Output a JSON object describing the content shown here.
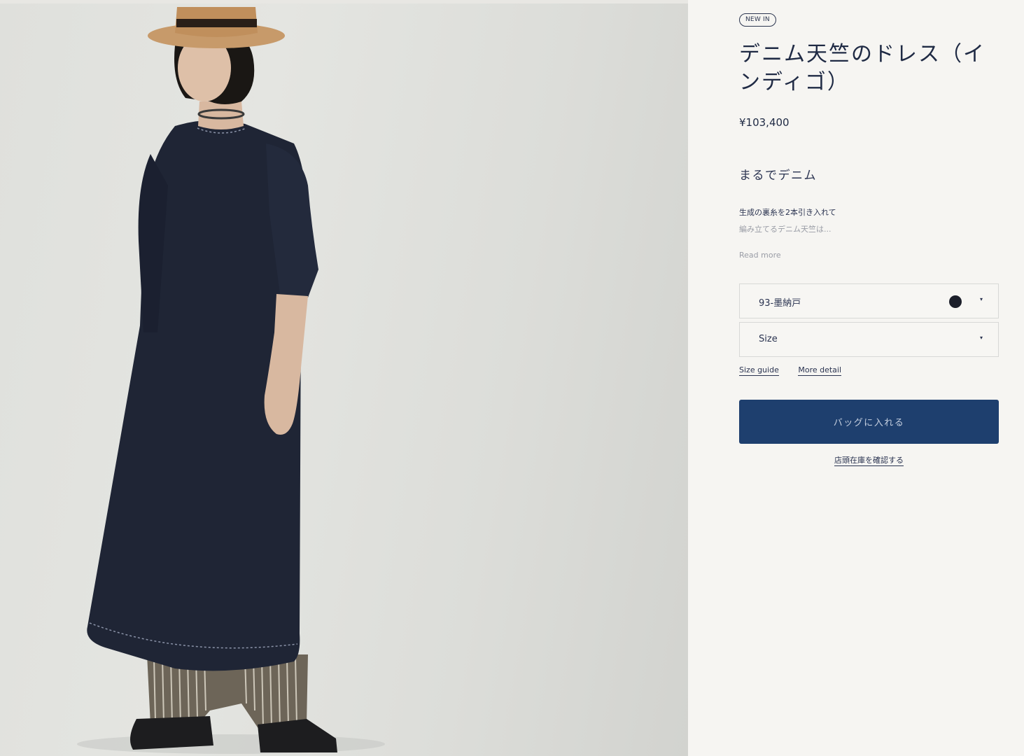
{
  "product": {
    "badge": "NEW IN",
    "title": "デニム天竺のドレス（インディゴ）",
    "price": "¥103,400",
    "subtitle": "まるでデニム",
    "description_line1": "生成の裏糸を2本引き入れて",
    "description_line2": "編み立てるデニム天竺は...",
    "read_more": "Read more"
  },
  "options": {
    "color_value": "93-墨納戸",
    "color_swatch": "#1c1f2a",
    "size_value": "Size"
  },
  "links": {
    "size_guide": "Size guide",
    "more_detail": "More detail"
  },
  "actions": {
    "add_to_bag": "バッグに入れる",
    "check_store_stock": "店頭在庫を確認する"
  },
  "colors": {
    "primary_button": "#1e3f6e",
    "text": "#1f2a44",
    "background": "#f6f5f2"
  },
  "icons": {
    "select_chevron": "▾"
  }
}
